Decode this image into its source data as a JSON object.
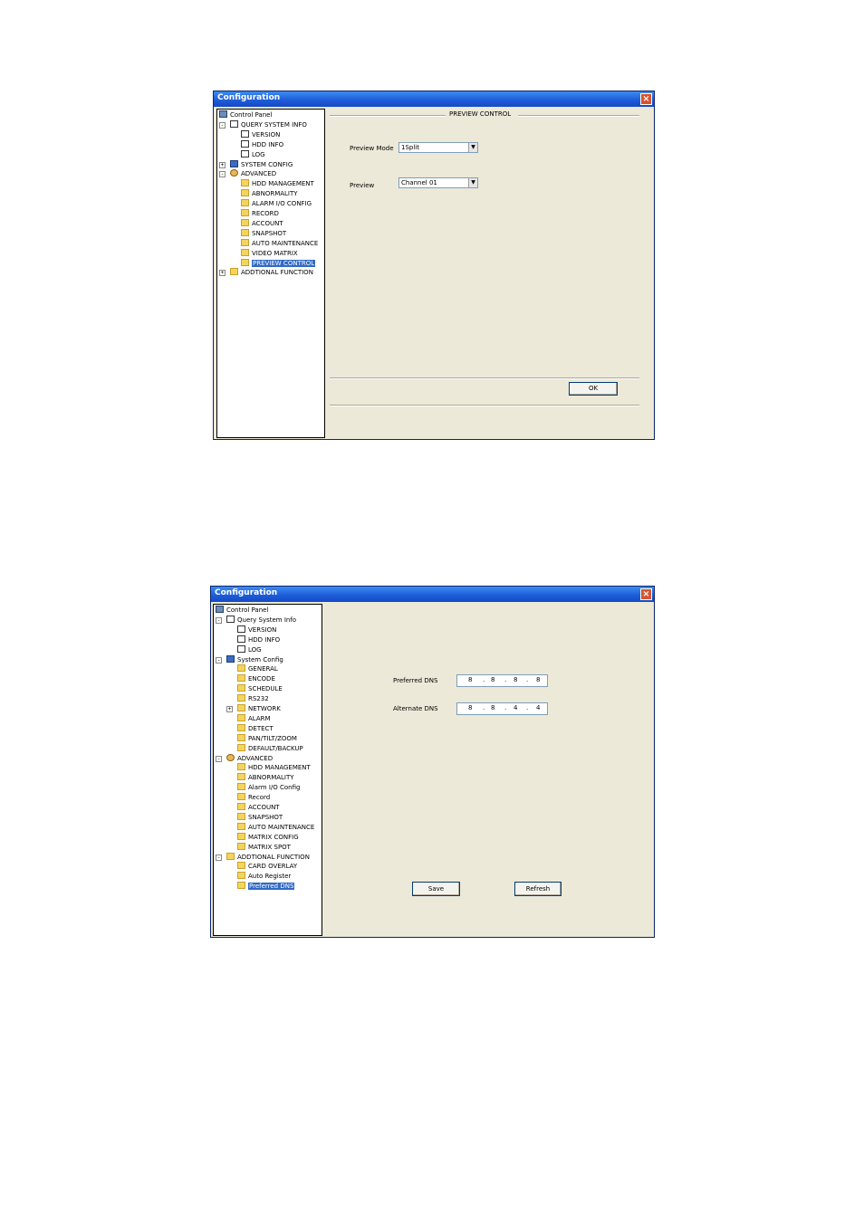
{
  "window1": {
    "title": "Configuration",
    "tree": [
      {
        "label": "Control Panel",
        "icon": "monitor-icon"
      },
      {
        "label": "QUERY SYSTEM INFO",
        "icon": "note-icon",
        "expander": "-"
      },
      {
        "label": "VERSION",
        "icon": "note-icon"
      },
      {
        "label": "HDD INFO",
        "icon": "note-icon"
      },
      {
        "label": "LOG",
        "icon": "note-icon"
      },
      {
        "label": "SYSTEM CONFIG",
        "icon": "system-icon",
        "expander": "+"
      },
      {
        "label": "ADVANCED",
        "icon": "gear-icon",
        "expander": "-"
      },
      {
        "label": "HDD MANAGEMENT",
        "icon": "folder-icon"
      },
      {
        "label": "ABNORMALITY",
        "icon": "folder-icon"
      },
      {
        "label": "ALARM I/O CONFIG",
        "icon": "folder-icon"
      },
      {
        "label": "RECORD",
        "icon": "folder-icon"
      },
      {
        "label": "ACCOUNT",
        "icon": "folder-icon"
      },
      {
        "label": "SNAPSHOT",
        "icon": "folder-icon"
      },
      {
        "label": "AUTO MAINTENANCE",
        "icon": "folder-icon"
      },
      {
        "label": "VIDEO MATRIX",
        "icon": "folder-icon"
      },
      {
        "label": "PREVIEW CONTROL",
        "icon": "folder-icon",
        "selected": true
      },
      {
        "label": "ADDTIONAL FUNCTION",
        "icon": "folder-icon",
        "expander": "+"
      }
    ],
    "section_title": "PREVIEW CONTROL",
    "preview_mode_label": "Preview Mode",
    "preview_mode_value": "1Split",
    "preview_label": "Preview",
    "preview_value": "Channel 01",
    "ok_label": "OK"
  },
  "window2": {
    "title": "Configuration",
    "tree": [
      {
        "label": "Control Panel",
        "icon": "monitor-icon"
      },
      {
        "label": "Query System Info",
        "icon": "note-icon",
        "expander": "-"
      },
      {
        "label": "VERSION",
        "icon": "note-icon"
      },
      {
        "label": "HDD INFO",
        "icon": "note-icon"
      },
      {
        "label": "LOG",
        "icon": "note-icon"
      },
      {
        "label": "System Config",
        "icon": "system-icon",
        "expander": "-"
      },
      {
        "label": "GENERAL",
        "icon": "folder-icon"
      },
      {
        "label": "ENCODE",
        "icon": "folder-icon"
      },
      {
        "label": "SCHEDULE",
        "icon": "folder-icon"
      },
      {
        "label": "RS232",
        "icon": "folder-icon"
      },
      {
        "label": "NETWORK",
        "icon": "folder-icon",
        "expander": "+"
      },
      {
        "label": "ALARM",
        "icon": "folder-icon"
      },
      {
        "label": "DETECT",
        "icon": "folder-icon"
      },
      {
        "label": "PAN/TILT/ZOOM",
        "icon": "folder-icon"
      },
      {
        "label": "DEFAULT/BACKUP",
        "icon": "folder-icon"
      },
      {
        "label": "ADVANCED",
        "icon": "gear-icon",
        "expander": "-"
      },
      {
        "label": "HDD MANAGEMENT",
        "icon": "folder-icon"
      },
      {
        "label": "ABNORMALITY",
        "icon": "folder-icon"
      },
      {
        "label": "Alarm I/O Config",
        "icon": "folder-icon"
      },
      {
        "label": "Record",
        "icon": "folder-icon"
      },
      {
        "label": "ACCOUNT",
        "icon": "folder-icon"
      },
      {
        "label": "SNAPSHOT",
        "icon": "folder-icon"
      },
      {
        "label": "AUTO MAINTENANCE",
        "icon": "folder-icon"
      },
      {
        "label": "MATRIX CONFIG",
        "icon": "folder-icon"
      },
      {
        "label": "MATRIX SPOT",
        "icon": "folder-icon"
      },
      {
        "label": "ADDTIONAL FUNCTION",
        "icon": "folder-icon",
        "expander": "-"
      },
      {
        "label": "CARD OVERLAY",
        "icon": "folder-icon"
      },
      {
        "label": "Auto Register",
        "icon": "folder-icon"
      },
      {
        "label": "Preferred DNS",
        "icon": "folder-icon",
        "selected": true
      }
    ],
    "preferred_dns_label": "Preferred DNS",
    "preferred_dns": [
      "8",
      "8",
      "8",
      "8"
    ],
    "alternate_dns_label": "Alternate DNS",
    "alternate_dns": [
      "8",
      "8",
      "4",
      "4"
    ],
    "save_label": "Save",
    "refresh_label": "Refresh"
  }
}
